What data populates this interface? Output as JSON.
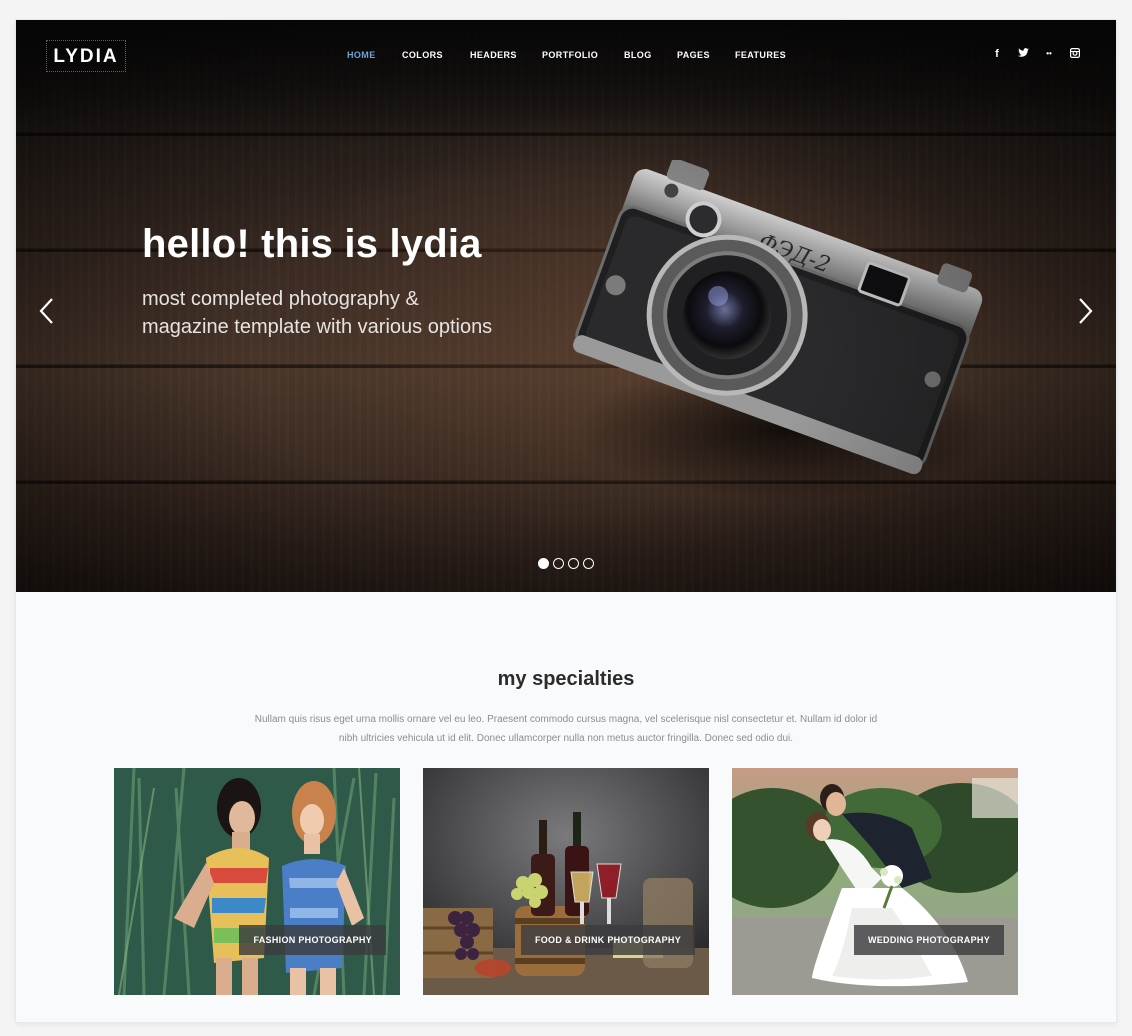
{
  "brand": {
    "logo": "LYDIA"
  },
  "nav": {
    "items": [
      {
        "label": "HOME",
        "active": true
      },
      {
        "label": "COLORS",
        "active": false
      },
      {
        "label": "HEADERS",
        "active": false
      },
      {
        "label": "PORTFOLIO",
        "active": false
      },
      {
        "label": "BLOG",
        "active": false
      },
      {
        "label": "PAGES",
        "active": false
      },
      {
        "label": "FEATURES",
        "active": false
      }
    ],
    "active_color": "#6aa6d8"
  },
  "social": {
    "icons": [
      "facebook-icon",
      "twitter-icon",
      "flickr-icon",
      "instagram-icon"
    ],
    "facebook_glyph": "f",
    "flickr_glyph": "••"
  },
  "hero": {
    "title": "hello! this is lydia",
    "subtitle_line1": "most completed photography &",
    "subtitle_line2": "magazine template with various options",
    "camera_text": "ФЭД-2",
    "slide_count": 4,
    "active_slide": 1
  },
  "specialties": {
    "title": "my specialties",
    "desc_line1": "Nullam quis risus eget urna mollis ornare vel eu leo. Praesent commodo cursus magna, vel scelerisque nisl consectetur et. Nullam id dolor id",
    "desc_line2": "nibh ultricies vehicula ut id elit. Donec ullamcorper nulla non metus auctor fringilla. Donec sed odio dui.",
    "cards": [
      {
        "label": "FASHION PHOTOGRAPHY"
      },
      {
        "label": "FOOD & DRINK PHOTOGRAPHY"
      },
      {
        "label": "WEDDING PHOTOGRAPHY"
      }
    ]
  }
}
